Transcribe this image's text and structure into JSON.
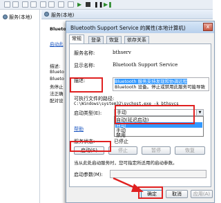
{
  "tree": {
    "item": "服务(本地)"
  },
  "services_pane": {
    "header": "服务(本地)",
    "left_texts": [
      "Blueto",
      "启动此",
      "描述:",
      "Blueto",
      "Blueto",
      "务停止",
      "法正确",
      "配对设"
    ]
  },
  "dialog": {
    "title": "Bluetooth Support Service 的属性(本地计算机)",
    "close_label": "x",
    "tabs": [
      "常规",
      "登录",
      "恢复",
      "依存关系"
    ],
    "service_name_label": "服务名称:",
    "service_name": "bthserv",
    "display_name_label": "显示名称:",
    "display_name": "Bluetooth Support Service",
    "description_label": "描述:",
    "description_highlight": "Bluetooth 服务支持发现和协调远程",
    "description_rest": "Bluetooth 设备。停止或禁用此服务可能导致",
    "path_label": "可执行文件的路径:",
    "path": "C:\\Windows\\system32\\svchost.exe -k bthsvcs",
    "startup_type_label": "启动类型(E):",
    "startup_type_value": "手动",
    "startup_options": [
      "自动(延迟启动)",
      "自动",
      "手动",
      "禁用"
    ],
    "help_link": "帮助",
    "status_label": "服务状态:",
    "status_value": "已停止",
    "start_hint": "当从此处启动服务时，您可指定所适用的启动参数。",
    "params_label": "启动参数(M):",
    "buttons": {
      "start": "启动(S)",
      "stop": "停止",
      "pause": "暂停",
      "resume": "恢复",
      "ok": "确定",
      "cancel": "取消",
      "apply": "应用(A)"
    }
  },
  "colors": {
    "highlight_red": "#e02020",
    "selection_blue": "#3399ff"
  }
}
